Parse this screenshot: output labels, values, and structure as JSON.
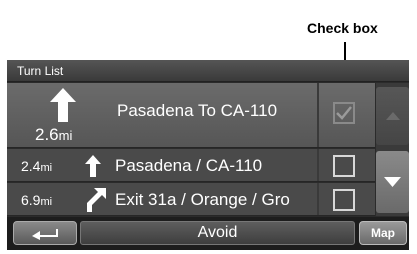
{
  "callout": {
    "label": "Check box"
  },
  "header": {
    "title": "Turn List"
  },
  "turns": [
    {
      "distance": "2.6",
      "unit": "mi",
      "street": "Pasadena To CA-110",
      "checked": true,
      "maneuver": "straight-arrow-icon"
    },
    {
      "distance": "2.4",
      "unit": "mi",
      "street": "Pasadena / CA-110",
      "checked": false,
      "maneuver": "straight-arrow-icon"
    },
    {
      "distance": "6.9",
      "unit": "mi",
      "street": "Exit 31a / Orange / Gro",
      "checked": false,
      "maneuver": "bear-right-arrow-icon"
    }
  ],
  "toolbar": {
    "avoid_label": "Avoid",
    "map_label": "Map",
    "back_icon": "back-arrow-icon"
  },
  "scrollbar": {
    "up_icon": "chevron-up-icon",
    "down_icon": "chevron-down-icon"
  }
}
